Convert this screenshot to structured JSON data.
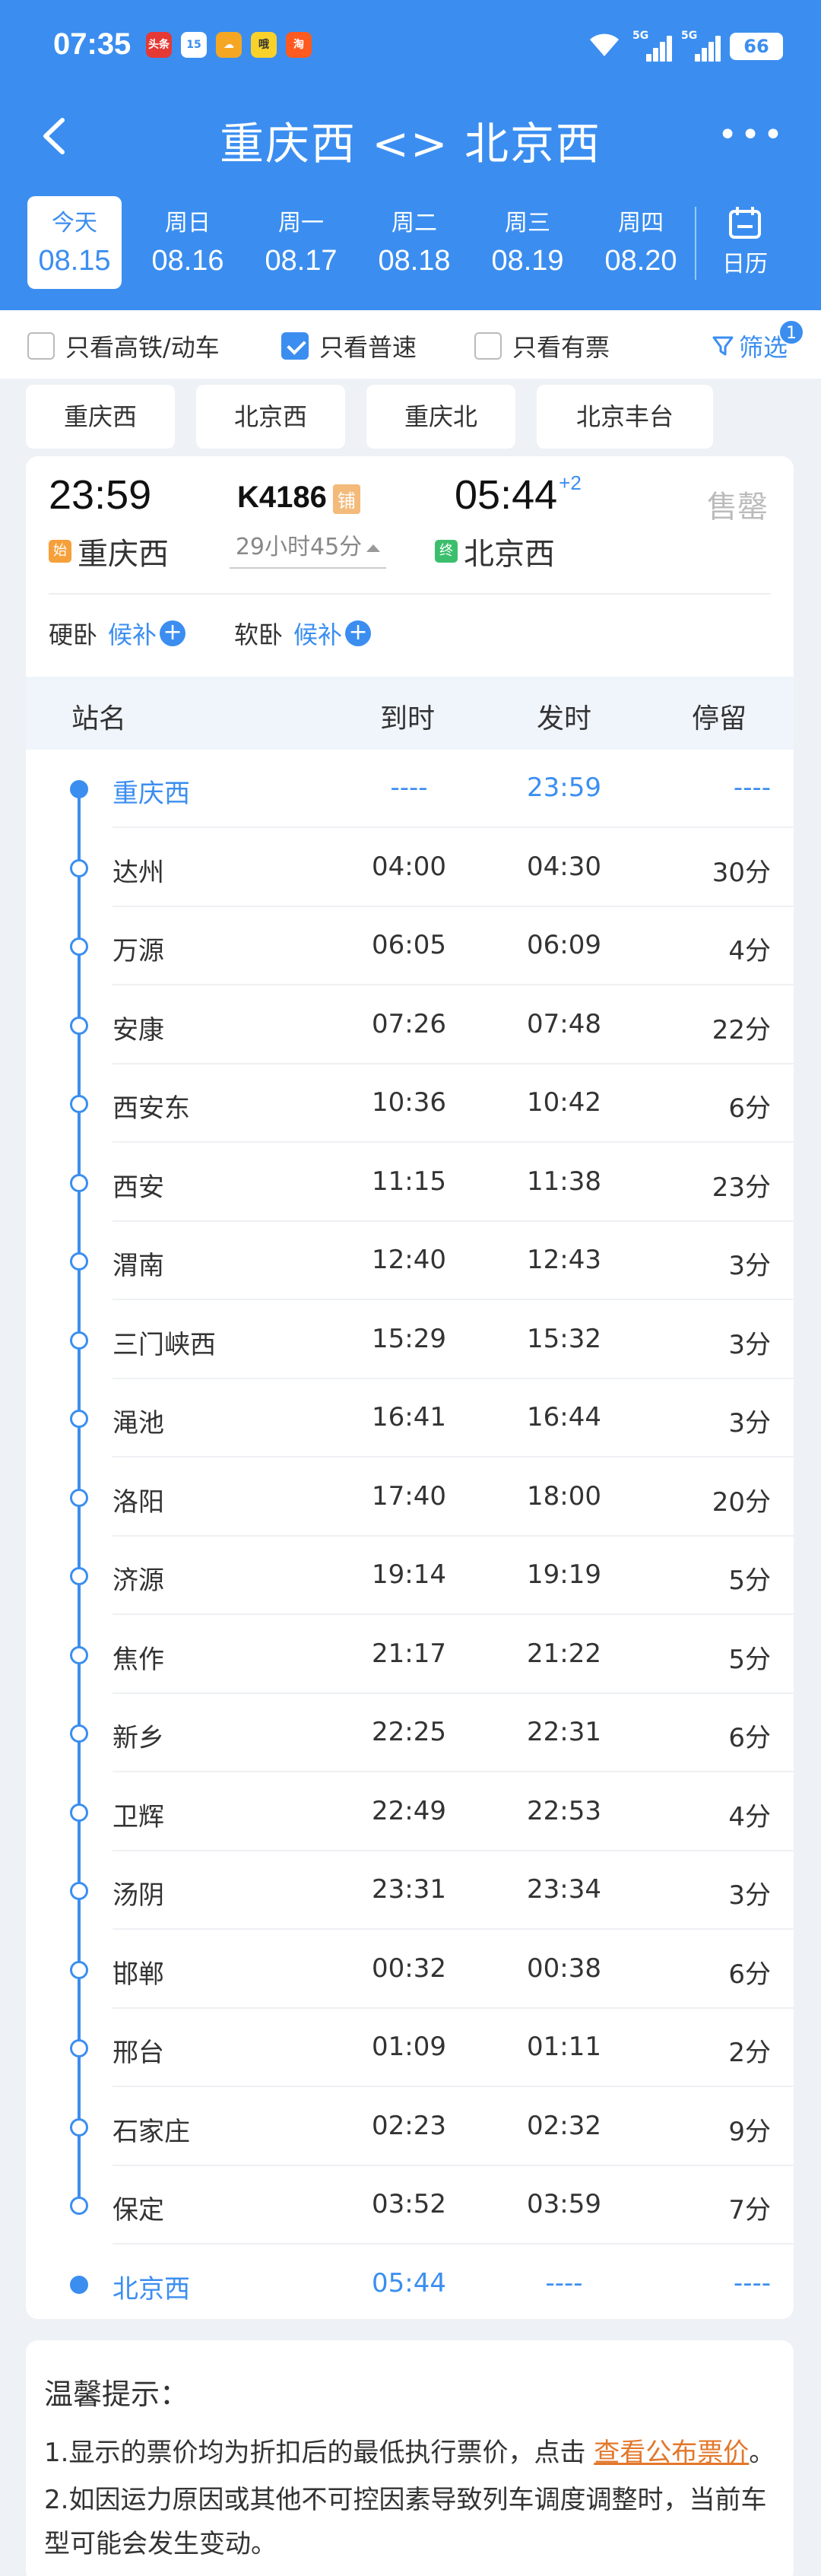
{
  "status": {
    "time": "07:35",
    "apps": [
      {
        "name": "toutiao-icon",
        "label": "头条",
        "color": "#e53935"
      },
      {
        "name": "calendar-app-icon",
        "label": "15",
        "color": "#ffffff"
      },
      {
        "name": "weather-icon",
        "label": "☁",
        "color": "#f5a623"
      },
      {
        "name": "app-icon",
        "label": "哦",
        "color": "#f8d22b"
      },
      {
        "name": "taobao-icon",
        "label": "淘",
        "color": "#ff5a1f"
      }
    ],
    "signal_label": "5G",
    "battery": "66"
  },
  "title": {
    "text": "重庆西 <> 北京西",
    "more": "•••"
  },
  "dates": [
    {
      "wk": "今天",
      "dt": "08.15",
      "active": true
    },
    {
      "wk": "周日",
      "dt": "08.16"
    },
    {
      "wk": "周一",
      "dt": "08.17"
    },
    {
      "wk": "周二",
      "dt": "08.18"
    },
    {
      "wk": "周三",
      "dt": "08.19"
    },
    {
      "wk": "周四",
      "dt": "08.20"
    }
  ],
  "calendar_label": "日历",
  "filters": {
    "high_speed": "只看高铁/动车",
    "normal": "只看普速",
    "has_ticket": "只看有票",
    "screen": "筛选",
    "screen_badge": "1"
  },
  "stations": [
    "重庆西",
    "北京西",
    "重庆北",
    "北京丰台"
  ],
  "train": {
    "dep_time": "23:59",
    "dep_station": "重庆西",
    "dep_tag": "始",
    "number": "K4186",
    "number_tag": "铺",
    "duration": "29小时45分",
    "arr_time": "05:44",
    "arr_plus": "+2",
    "arr_station": "北京西",
    "arr_tag": "终",
    "status": "售罄",
    "seats": [
      {
        "type": "硬卧",
        "action": "候补"
      },
      {
        "type": "软卧",
        "action": "候补"
      }
    ]
  },
  "table": {
    "headers": {
      "station": "站名",
      "arrive": "到时",
      "depart": "发时",
      "stop": "停留"
    },
    "rows": [
      {
        "name": "重庆西",
        "arr": "----",
        "dep": "23:59",
        "stop": "----"
      },
      {
        "name": "达州",
        "arr": "04:00",
        "dep": "04:30",
        "stop": "30分"
      },
      {
        "name": "万源",
        "arr": "06:05",
        "dep": "06:09",
        "stop": "4分"
      },
      {
        "name": "安康",
        "arr": "07:26",
        "dep": "07:48",
        "stop": "22分"
      },
      {
        "name": "西安东",
        "arr": "10:36",
        "dep": "10:42",
        "stop": "6分"
      },
      {
        "name": "西安",
        "arr": "11:15",
        "dep": "11:38",
        "stop": "23分"
      },
      {
        "name": "渭南",
        "arr": "12:40",
        "dep": "12:43",
        "stop": "3分"
      },
      {
        "name": "三门峡西",
        "arr": "15:29",
        "dep": "15:32",
        "stop": "3分"
      },
      {
        "name": "渑池",
        "arr": "16:41",
        "dep": "16:44",
        "stop": "3分"
      },
      {
        "name": "洛阳",
        "arr": "17:40",
        "dep": "18:00",
        "stop": "20分"
      },
      {
        "name": "济源",
        "arr": "19:14",
        "dep": "19:19",
        "stop": "5分"
      },
      {
        "name": "焦作",
        "arr": "21:17",
        "dep": "21:22",
        "stop": "5分"
      },
      {
        "name": "新乡",
        "arr": "22:25",
        "dep": "22:31",
        "stop": "6分"
      },
      {
        "name": "卫辉",
        "arr": "22:49",
        "dep": "22:53",
        "stop": "4分"
      },
      {
        "name": "汤阴",
        "arr": "23:31",
        "dep": "23:34",
        "stop": "3分"
      },
      {
        "name": "邯郸",
        "arr": "00:32",
        "dep": "00:38",
        "stop": "6分"
      },
      {
        "name": "邢台",
        "arr": "01:09",
        "dep": "01:11",
        "stop": "2分"
      },
      {
        "name": "石家庄",
        "arr": "02:23",
        "dep": "02:32",
        "stop": "9分"
      },
      {
        "name": "保定",
        "arr": "03:52",
        "dep": "03:59",
        "stop": "7分"
      },
      {
        "name": "北京西",
        "arr": "05:44",
        "dep": "----",
        "stop": "----"
      }
    ]
  },
  "notes": {
    "title": "温馨提示：",
    "line1_pre": "1.显示的票价均为折扣后的最低执行票价，点击 ",
    "line1_link": "查看公布票价",
    "line1_post": "。",
    "line2": "2.如因运力原因或其他不可控因素导致列车调度调整时，当前车",
    "line3": "型可能会发生变动。"
  }
}
